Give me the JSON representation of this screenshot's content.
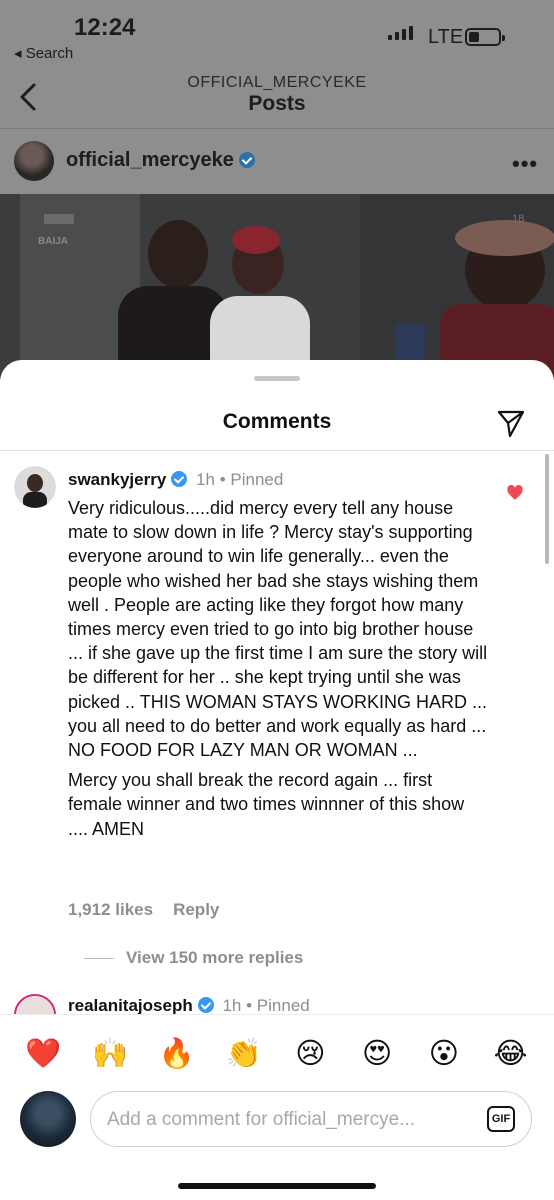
{
  "status_bar": {
    "time": "12:24",
    "back_app": "◂ Search",
    "network": "LTE"
  },
  "nav": {
    "subtitle": "OFFICIAL_MERCYEKE",
    "title": "Posts"
  },
  "post": {
    "username": "official_mercyeke",
    "verified": true,
    "more_label": "•••",
    "image_watermark": "18"
  },
  "sheet": {
    "title": "Comments"
  },
  "comments": [
    {
      "username": "swankyjerry",
      "verified": true,
      "time": "1h",
      "pinned": "Pinned",
      "liked": true,
      "body_paragraph_1": "Very ridiculous.....did mercy every tell any house mate to slow down in life ? Mercy stay's supporting everyone around to win life generally... even the people who wished her bad she stays wishing them well . People are acting like they forgot how many times mercy even tried to go into big brother house ... if she gave up the first time I am sure the story will be different for her .. she kept trying until she was picked .. THIS WOMAN STAYS WORKING HARD ... you all need to do better and work equally as hard ... NO FOOD FOR LAZY MAN OR WOMAN ...",
      "body_paragraph_2": "Mercy you shall break the record again ... first female winner and two times winnner of this show .... AMEN",
      "likes": "1,912 likes",
      "reply_label": "Reply",
      "view_replies": "View 150 more replies"
    },
    {
      "username": "realanitajoseph",
      "verified": true,
      "time": "1h",
      "pinned": "Pinned"
    }
  ],
  "composer": {
    "emojis": [
      "❤️",
      "🙌",
      "🔥",
      "👏",
      "😢",
      "😍",
      "😮",
      "😂"
    ],
    "placeholder": "Add a comment for official_mercye...",
    "gif_label": "GIF"
  },
  "colors": {
    "verified": "#3897f0",
    "like": "#ed4956",
    "muted_text": "#8e8e8e"
  }
}
